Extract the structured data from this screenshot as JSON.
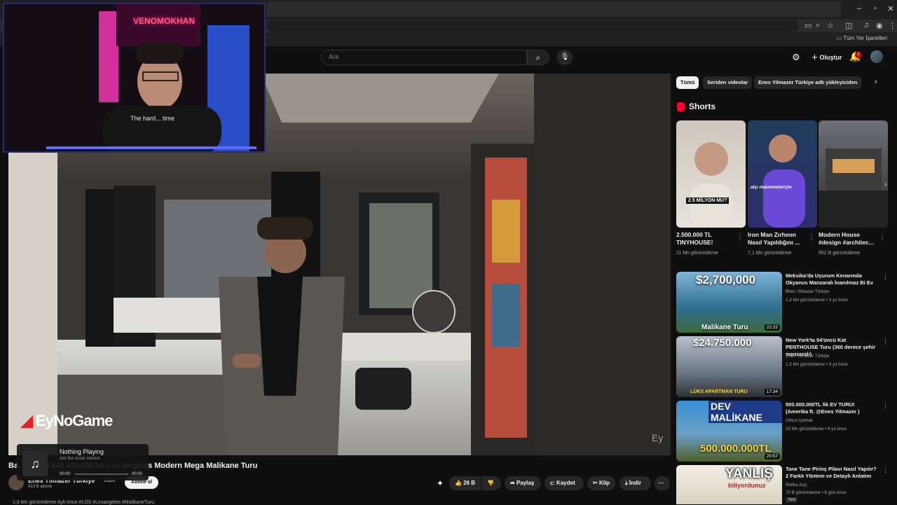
{
  "browser": {
    "window_controls": [
      "–",
      "▫",
      "✕"
    ],
    "bookmarks_label": "Tüm Yer İşaretleri"
  },
  "header": {
    "search_placeholder": "Ara",
    "create_label": "Oluştur",
    "notification_count": "2"
  },
  "webcam": {
    "name_sign": "VENOMOKHAN",
    "shirt_text": "The hard... time"
  },
  "player": {
    "stream_logo": "EyNoGame",
    "corner_mark": "Ey"
  },
  "music": {
    "title": "Nothing Playing",
    "subtitle": "Get the music started",
    "time_start": "00:00",
    "time_end": "00:00"
  },
  "video": {
    "title": "Ba... ... han $45.000.000'lık Los Angeles Modern Mega Malikane Turu",
    "channel": "Enes Yılmazer Türkiye",
    "subs": "913 B abone",
    "join": "Katıl",
    "subscribe": "Abone ol",
    "likes": "26 B",
    "share": "Paylaş",
    "save": "Kaydet",
    "clip": "Klip",
    "download": "İndir",
    "desc_line": "1,6 Mn görüntüleme  Aylı önce  #LOS  #Losangeles  #MalikaneTuru"
  },
  "chips": [
    "Tümü",
    "Seriden videolar",
    "Enes Yilmazer Türkiye adlı yükleyiciden"
  ],
  "shorts": {
    "header": "Shorts",
    "items": [
      {
        "title": "2.500.000 TL TINYHOUSE!",
        "views": "11 Mn görüntüleme",
        "overlay": "2.5 MİLYON MU?"
      },
      {
        "title": "Iron Man Zırhının Nasıl Yapıldığını ...",
        "views": "7,1 Mn görüntüleme",
        "overlay": "alçı malzemeleriyle"
      },
      {
        "title": "Modern House #design #architec...",
        "views": "562 B görüntüleme",
        "overlay": ""
      }
    ]
  },
  "recs": [
    {
      "title": "Meksika'da Uçurum Kenarında Okyanus Manzaralı İnanılmaz Bi Ev ...",
      "channel": "Enes Yilmazer Türkiye",
      "meta": "1,3 Mn görüntüleme • 3 yıl önce",
      "duration": "22:22",
      "thumb_big": "$2,700,000",
      "thumb_small": "Malikane Turu"
    },
    {
      "title": "New York'ta 54'üncü Kat PENTHOUSE Turu (360 derece şehir manzaralı)",
      "channel": "Enes Yilmazer Türkiye",
      "meta": "1,3 Mn görüntüleme • 3 yıl önce",
      "duration": "17:34",
      "thumb_big": "$24.750.000",
      "thumb_small": "LÜKS APARTMAN TURU"
    },
    {
      "title": "500.000.000TL lik EV TURU! (Amerika ft. @Enes Yilmazer )",
      "channel": "Orkun Işıtmak",
      "meta": "10 Mn görüntüleme • 4 yıl önce",
      "duration": "20:57",
      "thumb_big": "DEV MALİKANE",
      "thumb_small": "500.000.000TL"
    },
    {
      "title": "Tane Tane Pirinç Pilavı Nasıl Yapılır? 2 Farklı Yöntem ve Detaylı Anlatım",
      "channel": "Refika Koç",
      "meta": "70 B görüntüleme • 6 gün önce",
      "duration": "",
      "thumb_big": "YANLIŞ",
      "thumb_small": "biliyordunuz",
      "badge": "Yeni"
    }
  ]
}
